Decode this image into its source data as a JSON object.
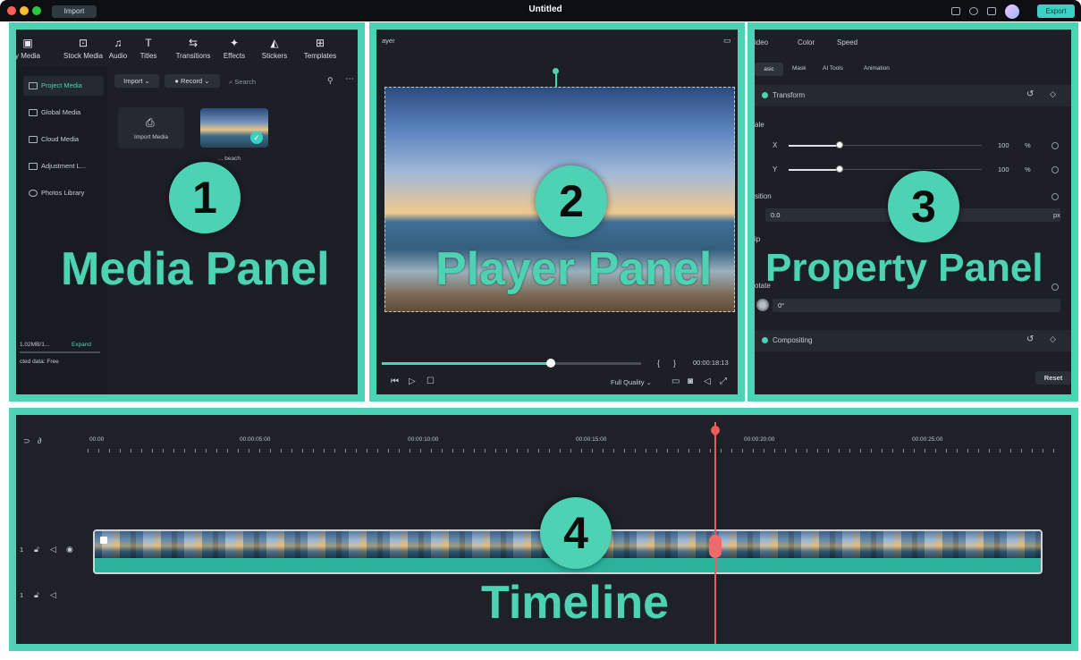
{
  "window": {
    "title": "Untitled",
    "tab": "Import",
    "export_label": "Export"
  },
  "media_panel": {
    "callout_number": "1",
    "callout_label": "Media Panel",
    "toolbar": [
      "y Media",
      "Stock Media",
      "Audio",
      "Titles",
      "Transitions",
      "Effects",
      "Stickers",
      "Templates"
    ],
    "import_label": "Import",
    "record_label": "Record",
    "search_placeholder": "Search",
    "sidebar": [
      "Project Media",
      "Global Media",
      "Cloud Media",
      "Adjustment L...",
      "Photos Library"
    ],
    "import_media_label": "Import Media",
    "thumb_caption": "... beach",
    "storage_text": "1.02MB/1...",
    "expand_label": "Expand",
    "storage_free": "cted data: Free"
  },
  "player_panel": {
    "callout_number": "2",
    "callout_label": "Player Panel",
    "header": "ayer",
    "time_position": "00:00:18:13",
    "playback_progress": 0.66,
    "quality_label": "Full Quality"
  },
  "property_panel": {
    "callout_number": "3",
    "callout_label": "Property Panel",
    "tabs": [
      "ideo",
      "Color",
      "Speed"
    ],
    "subtabs": [
      "asic",
      "Mask",
      "AI Tools",
      "Animation"
    ],
    "transform_label": "Transform",
    "scale_label": "ale",
    "x_label": "X",
    "y_label": "Y",
    "x_value": "100",
    "y_value": "100",
    "percent_unit": "%",
    "position_label": "sition",
    "position_value": "0.0",
    "px_unit": "px",
    "flip_label": "ip",
    "rotate_label": "otate",
    "rotate_value": "0°",
    "compositing_label": "Compositing",
    "reset_label": "Reset"
  },
  "timeline": {
    "callout_number": "4",
    "callout_label": "Timeline",
    "timecodes": [
      "00:00",
      "00:00:05:00",
      "00:00:10:00",
      "00:00:15:00",
      "00:00:20:00",
      "00:00:25:00"
    ]
  },
  "colors": {
    "accent": "#4dd3b4",
    "playhead": "#ee5a5a",
    "export_button": "#3bd2c5"
  }
}
